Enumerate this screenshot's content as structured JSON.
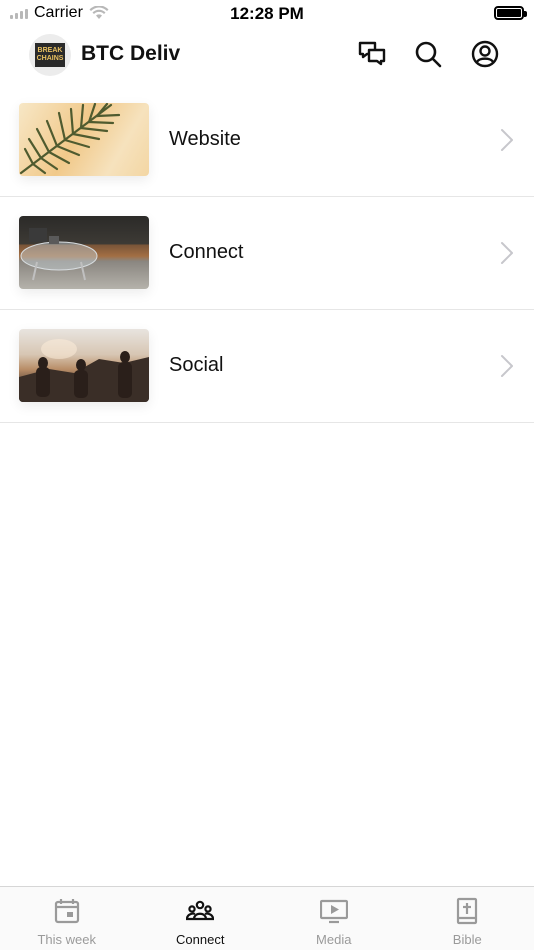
{
  "status_bar": {
    "carrier": "Carrier",
    "time": "12:28 PM"
  },
  "header": {
    "title": "BTC Deliv",
    "logo_text": "BREAK CHAINS",
    "icons": [
      "chat-icon",
      "search-icon",
      "account-icon"
    ]
  },
  "list": {
    "items": [
      {
        "label": "Website",
        "thumbnail": "palm-leaf-photo"
      },
      {
        "label": "Connect",
        "thumbnail": "coffee-table-photo"
      },
      {
        "label": "Social",
        "thumbnail": "friends-sunset-photo"
      }
    ]
  },
  "tab_bar": {
    "tabs": [
      {
        "label": "This week",
        "icon": "calendar-icon",
        "active": false
      },
      {
        "label": "Connect",
        "icon": "group-icon",
        "active": true
      },
      {
        "label": "Media",
        "icon": "play-screen-icon",
        "active": false
      },
      {
        "label": "Bible",
        "icon": "bible-icon",
        "active": false
      }
    ]
  },
  "colors": {
    "active_tab": "#111111",
    "inactive_tab": "#9a9a9a",
    "divider": "#e6e6e6",
    "chevron": "#c7c7cc"
  }
}
